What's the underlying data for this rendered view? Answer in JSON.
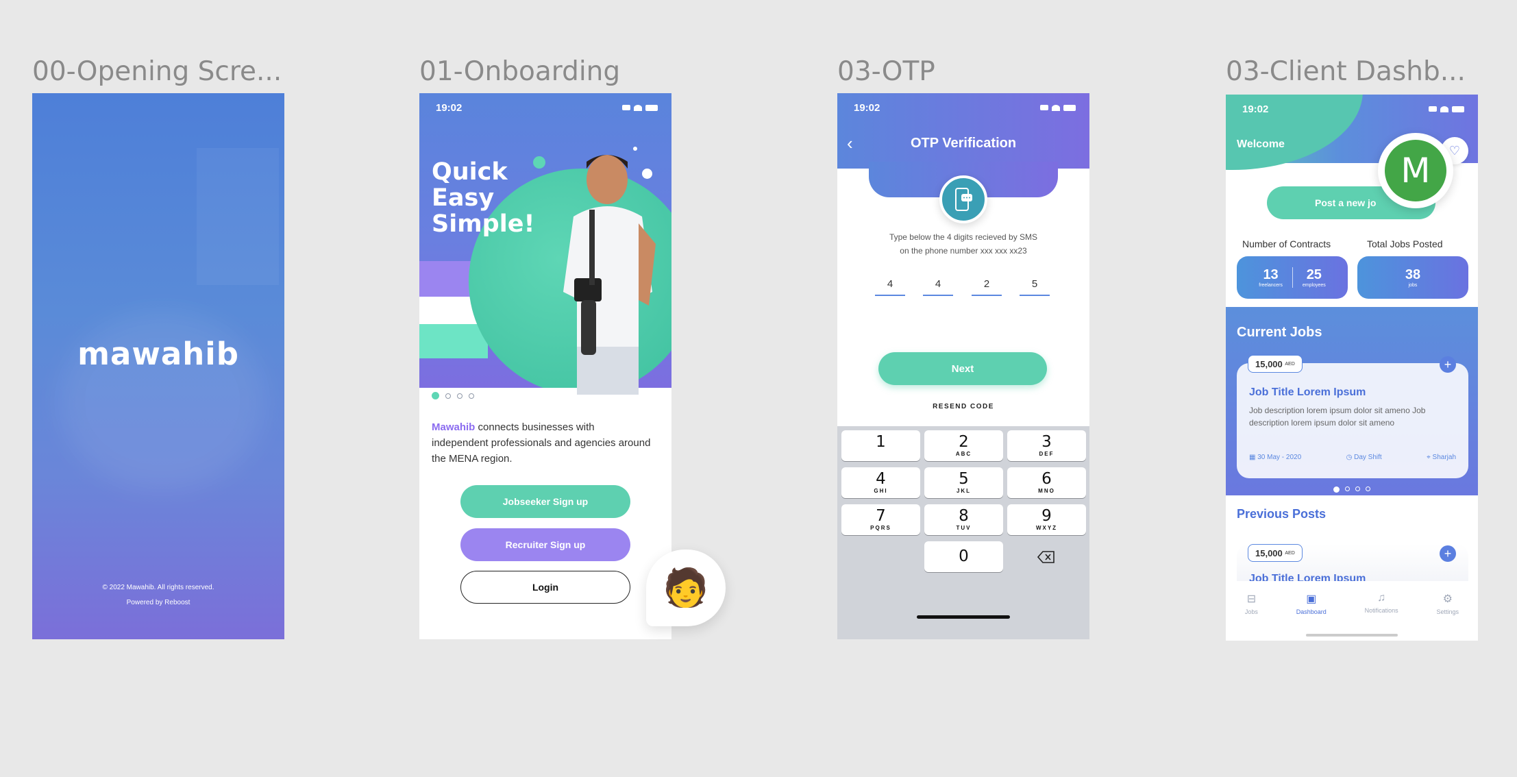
{
  "frames": {
    "opening": {
      "title": "00-Opening Scre...",
      "logo": "mawahib",
      "copyright": "© 2022 Mawahib. All rights reserved.",
      "powered": "Powered by Reboost"
    },
    "onboarding": {
      "title": "01-Onboarding",
      "time": "19:02",
      "headline": [
        "Quick",
        "Easy",
        "Simple!"
      ],
      "brand": "Mawahib",
      "intro": " connects businesses with independent professionals and agencies around the MENA region.",
      "jobseeker": "Jobseeker Sign up",
      "recruiter": "Recruiter Sign up",
      "login": "Login"
    },
    "otp": {
      "title": "03-OTP",
      "time": "19:02",
      "heading": "OTP Verification",
      "line1": "Type below the 4 digits recieved by SMS",
      "line2": "on the phone number xxx xxx xx23",
      "digits": [
        "4",
        "4",
        "2",
        "5"
      ],
      "next": "Next",
      "resend": "RESEND CODE",
      "keys": [
        {
          "n": "1",
          "l": ""
        },
        {
          "n": "2",
          "l": "ABC"
        },
        {
          "n": "3",
          "l": "DEF"
        },
        {
          "n": "4",
          "l": "GHI"
        },
        {
          "n": "5",
          "l": "JKL"
        },
        {
          "n": "6",
          "l": "MNO"
        },
        {
          "n": "7",
          "l": "PQRS"
        },
        {
          "n": "8",
          "l": "TUV"
        },
        {
          "n": "9",
          "l": "WXYZ"
        },
        {
          "n": "0",
          "l": ""
        }
      ]
    },
    "dashboard": {
      "title": "03-Client Dashb...",
      "time": "19:02",
      "welcome": "Welcome",
      "avatar_letter": "M",
      "post": "Post a new jo",
      "contracts_label": "Number of Contracts",
      "jobs_label": "Total Jobs Posted",
      "freelancers": "13",
      "freelancers_lbl": "freelancers",
      "employees": "25",
      "employees_lbl": "employees",
      "jobs": "38",
      "jobs_lbl": "jobs",
      "current": "Current Jobs",
      "salary": "15,000",
      "currency": "AED",
      "job_title": "Job Title Lorem Ipsum",
      "job_desc": "Job description lorem ipsum dolor sit ameno Job description lorem ipsum dolor sit ameno",
      "date": "30 May - 2020",
      "shift": "Day Shift",
      "city": "Sharjah",
      "previous": "Previous Posts",
      "nav": [
        "Jobs",
        "Dashboard",
        "Notifications",
        "Settings"
      ]
    }
  },
  "colors": {
    "teal": "#5ed0b0",
    "purple": "#8b6cf0",
    "blue": "#5b88e0"
  }
}
